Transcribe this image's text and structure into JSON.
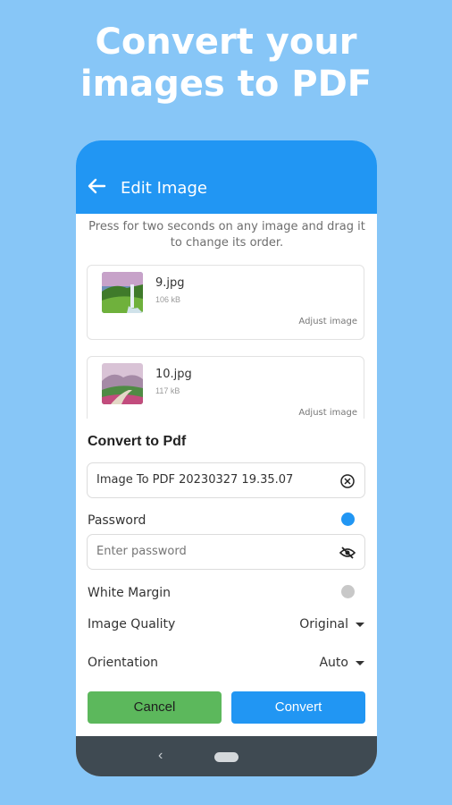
{
  "headline": {
    "line1": "Convert your",
    "line2": "images to PDF"
  },
  "appbar": {
    "title": "Edit Image",
    "back_icon": "arrow-left-icon",
    "color": "#2196f3"
  },
  "hint": {
    "line1": "Press for two seconds on any image and drag it",
    "line2": "to change its order."
  },
  "images": [
    {
      "name": "9.jpg",
      "size": "106 kB",
      "action": "Adjust image"
    },
    {
      "name": "10.jpg",
      "size": "117 kB",
      "action": "Adjust image"
    }
  ],
  "convert": {
    "section_title": "Convert to Pdf",
    "filename": "Image To PDF 20230327 19.35.07",
    "password_label": "Password",
    "password_enabled": true,
    "password_placeholder": "Enter password",
    "white_margin_label": "White Margin",
    "white_margin_enabled": false,
    "quality_label": "Image Quality",
    "quality_value": "Original",
    "orientation_label": "Orientation",
    "orientation_value": "Auto",
    "cancel_label": "Cancel",
    "convert_label": "Convert"
  },
  "colors": {
    "background": "#87c6f7",
    "accent": "#2196f3",
    "cancel": "#5cb85c",
    "toggle_off": "#c8c8c8"
  }
}
